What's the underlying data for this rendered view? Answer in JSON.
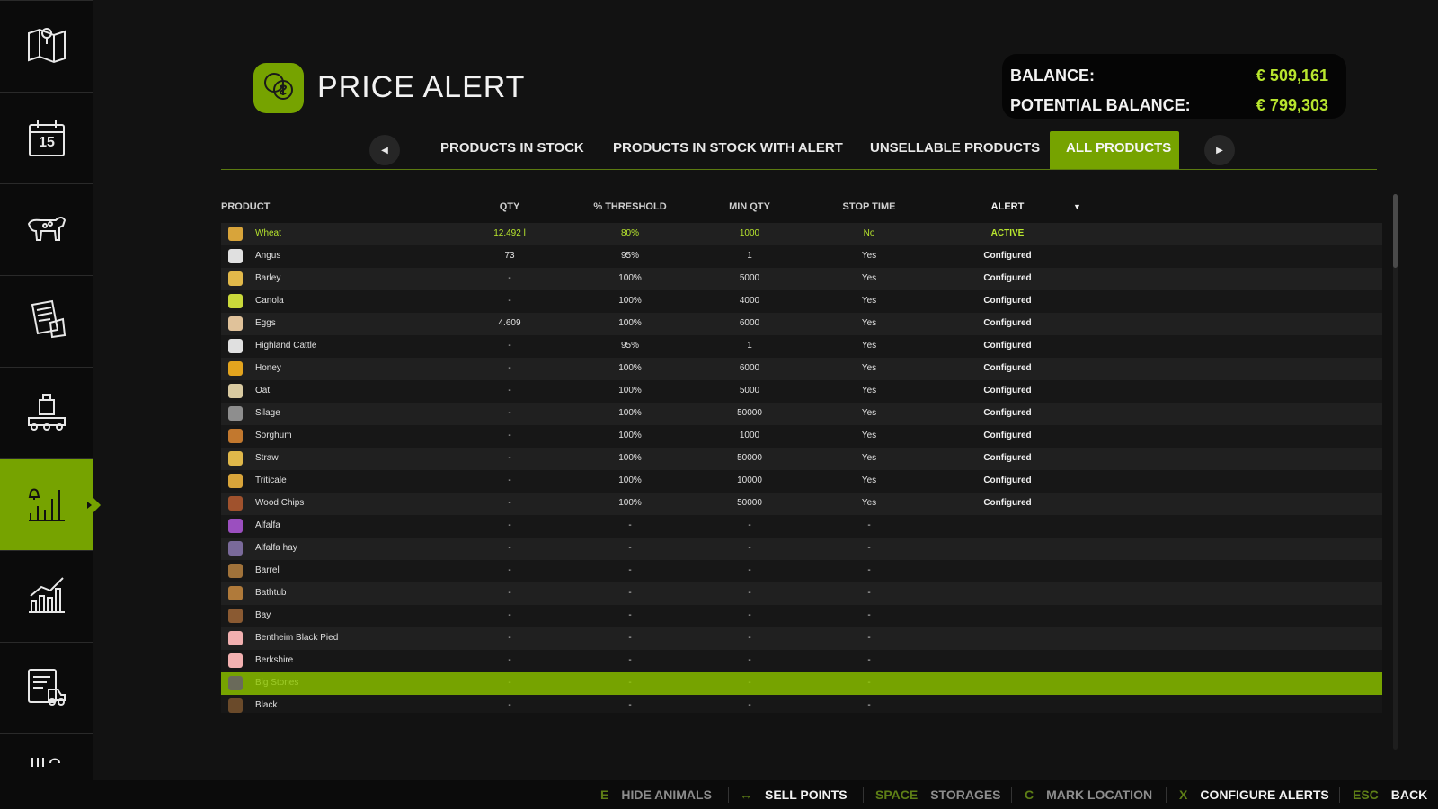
{
  "sidebar": {
    "items": [
      {
        "icon": "map-icon"
      },
      {
        "icon": "calendar-icon",
        "calendar_day": "15"
      },
      {
        "icon": "cow-icon"
      },
      {
        "icon": "contracts-icon"
      },
      {
        "icon": "production-icon"
      },
      {
        "icon": "price-alert-chart-icon",
        "active": true
      },
      {
        "icon": "statistics-icon"
      },
      {
        "icon": "vehicle-list-icon"
      },
      {
        "icon": "more-icon"
      }
    ]
  },
  "header": {
    "title": "PRICE ALERT",
    "icon": "coins-icon"
  },
  "balance": {
    "balance_label": "BALANCE:",
    "balance_value": "€ 509,161",
    "potential_label": "POTENTIAL BALANCE:",
    "potential_value": "€ 799,303"
  },
  "tabs": [
    {
      "label": "PRODUCTS IN STOCK",
      "active": false
    },
    {
      "label": "PRODUCTS IN STOCK WITH ALERT",
      "active": false
    },
    {
      "label": "UNSELLABLE PRODUCTS",
      "active": false
    },
    {
      "label": "ALL PRODUCTS",
      "active": true
    }
  ],
  "table": {
    "headers": {
      "product": "PRODUCT",
      "qty": "QTY",
      "threshold": "% THRESHOLD",
      "min_qty": "MIN QTY",
      "stop_time": "STOP TIME",
      "alert": "ALERT"
    },
    "sort_indicator": "▼",
    "rows": [
      {
        "name": "Wheat",
        "qty": "12.492 l",
        "threshold": "80%",
        "min_qty": "1000",
        "stop": "No",
        "alert": "ACTIVE",
        "active": true,
        "icon_color": "#d8a43a"
      },
      {
        "name": "Angus",
        "qty": "73",
        "threshold": "95%",
        "min_qty": "1",
        "stop": "Yes",
        "alert": "Configured",
        "icon_color": "#e0e0e0"
      },
      {
        "name": "Barley",
        "qty": "-",
        "threshold": "100%",
        "min_qty": "5000",
        "stop": "Yes",
        "alert": "Configured",
        "icon_color": "#e2b94a"
      },
      {
        "name": "Canola",
        "qty": "-",
        "threshold": "100%",
        "min_qty": "4000",
        "stop": "Yes",
        "alert": "Configured",
        "icon_color": "#c9d83a"
      },
      {
        "name": "Eggs",
        "qty": "4.609",
        "threshold": "100%",
        "min_qty": "6000",
        "stop": "Yes",
        "alert": "Configured",
        "icon_color": "#e0c29a"
      },
      {
        "name": "Highland Cattle",
        "qty": "-",
        "threshold": "95%",
        "min_qty": "1",
        "stop": "Yes",
        "alert": "Configured",
        "icon_color": "#e0e0e0"
      },
      {
        "name": "Honey",
        "qty": "-",
        "threshold": "100%",
        "min_qty": "6000",
        "stop": "Yes",
        "alert": "Configured",
        "icon_color": "#e3a41e"
      },
      {
        "name": "Oat",
        "qty": "-",
        "threshold": "100%",
        "min_qty": "5000",
        "stop": "Yes",
        "alert": "Configured",
        "icon_color": "#d8c9a0"
      },
      {
        "name": "Silage",
        "qty": "-",
        "threshold": "100%",
        "min_qty": "50000",
        "stop": "Yes",
        "alert": "Configured",
        "icon_color": "#8e8e8e"
      },
      {
        "name": "Sorghum",
        "qty": "-",
        "threshold": "100%",
        "min_qty": "1000",
        "stop": "Yes",
        "alert": "Configured",
        "icon_color": "#c2782e"
      },
      {
        "name": "Straw",
        "qty": "-",
        "threshold": "100%",
        "min_qty": "50000",
        "stop": "Yes",
        "alert": "Configured",
        "icon_color": "#e0b84a"
      },
      {
        "name": "Triticale",
        "qty": "-",
        "threshold": "100%",
        "min_qty": "10000",
        "stop": "Yes",
        "alert": "Configured",
        "icon_color": "#d8a43a"
      },
      {
        "name": "Wood Chips",
        "qty": "-",
        "threshold": "100%",
        "min_qty": "50000",
        "stop": "Yes",
        "alert": "Configured",
        "icon_color": "#a0522d"
      },
      {
        "name": "Alfalfa",
        "qty": "-",
        "threshold": "-",
        "min_qty": "-",
        "stop": "-",
        "alert": "",
        "icon_color": "#9b4fbf"
      },
      {
        "name": "Alfalfa hay",
        "qty": "-",
        "threshold": "-",
        "min_qty": "-",
        "stop": "-",
        "alert": "",
        "icon_color": "#7a6a9a"
      },
      {
        "name": "Barrel",
        "qty": "-",
        "threshold": "-",
        "min_qty": "-",
        "stop": "-",
        "alert": "",
        "icon_color": "#a0723a"
      },
      {
        "name": "Bathtub",
        "qty": "-",
        "threshold": "-",
        "min_qty": "-",
        "stop": "-",
        "alert": "",
        "icon_color": "#b07a3a"
      },
      {
        "name": "Bay",
        "qty": "-",
        "threshold": "-",
        "min_qty": "-",
        "stop": "-",
        "alert": "",
        "icon_color": "#8a5a32"
      },
      {
        "name": "Bentheim Black Pied",
        "qty": "-",
        "threshold": "-",
        "min_qty": "-",
        "stop": "-",
        "alert": "",
        "icon_color": "#f2b0b0"
      },
      {
        "name": "Berkshire",
        "qty": "-",
        "threshold": "-",
        "min_qty": "-",
        "stop": "-",
        "alert": "",
        "icon_color": "#f2b0b0"
      },
      {
        "name": "Big Stones",
        "qty": "-",
        "threshold": "-",
        "min_qty": "-",
        "stop": "-",
        "alert": "",
        "icon_color": "#6a6a5a",
        "highlight": true
      },
      {
        "name": "Black",
        "qty": "-",
        "threshold": "-",
        "min_qty": "-",
        "stop": "-",
        "alert": "",
        "icon_color": "#6a4a2a"
      }
    ]
  },
  "footer": {
    "items": [
      {
        "key": "E",
        "label": "HIDE ANIMALS",
        "bright": false
      },
      {
        "key": "↔",
        "label": "SELL POINTS",
        "bright": true
      },
      {
        "key": "SPACE",
        "label": "STORAGES",
        "bright": false
      },
      {
        "key": "C",
        "label": "MARK LOCATION",
        "bright": false
      },
      {
        "key": "X",
        "label": "CONFIGURE ALERTS",
        "bright": true
      },
      {
        "key": "ESC",
        "label": "BACK",
        "bright": true
      }
    ]
  },
  "colors": {
    "accent": "#76a300",
    "accent_text": "#b8e62e",
    "background": "#121212"
  }
}
